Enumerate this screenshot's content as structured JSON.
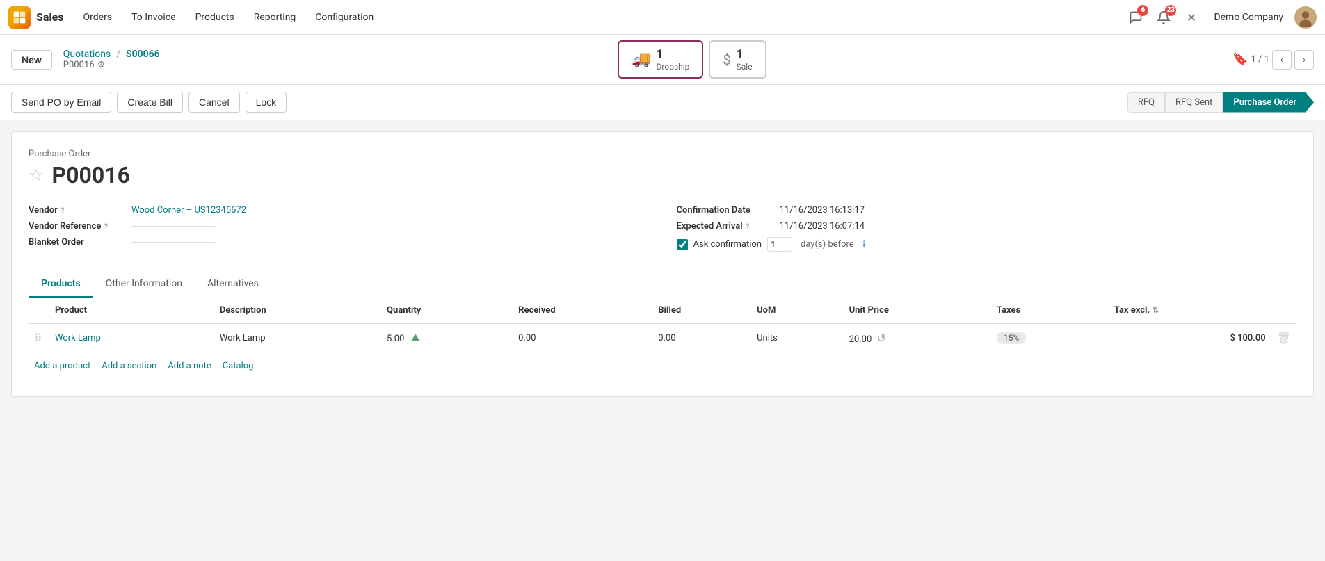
{
  "app": {
    "name": "Sales",
    "logo_color": "#f0a500"
  },
  "nav": {
    "items": [
      "Orders",
      "To Invoice",
      "Products",
      "Reporting",
      "Configuration"
    ],
    "company": "Demo Company",
    "notifications_count": "6",
    "messages_count": "23"
  },
  "breadcrumb": {
    "new_label": "New",
    "quotations_label": "Quotations",
    "current_label": "S00066",
    "po_ref": "P00016"
  },
  "smart_buttons": {
    "dropship": {
      "icon": "🚚",
      "label": "Dropship",
      "count": "1"
    },
    "sale": {
      "label": "Sale",
      "count": "1"
    }
  },
  "pagination": {
    "current": "1",
    "total": "1"
  },
  "action_buttons": {
    "send_po": "Send PO by Email",
    "create_bill": "Create Bill",
    "cancel": "Cancel",
    "lock": "Lock"
  },
  "status_steps": {
    "rfq": "RFQ",
    "rfq_sent": "RFQ Sent",
    "purchase_order": "Purchase Order"
  },
  "form": {
    "header_label": "Purchase Order",
    "po_number": "P00016",
    "vendor_label": "Vendor",
    "vendor_help": "?",
    "vendor_value": "Wood Corner – US12345672",
    "vendor_ref_label": "Vendor Reference",
    "vendor_ref_help": "?",
    "blanket_order_label": "Blanket Order",
    "confirmation_date_label": "Confirmation Date",
    "confirmation_date_value": "11/16/2023 16:13:17",
    "expected_arrival_label": "Expected Arrival",
    "expected_arrival_help": "?",
    "expected_arrival_value": "11/16/2023 16:07:14",
    "ask_confirmation_label": "Ask confirmation",
    "ask_confirmation_value": "1",
    "days_before_label": "day(s) before"
  },
  "tabs": {
    "products": "Products",
    "other_info": "Other Information",
    "alternatives": "Alternatives"
  },
  "table": {
    "headers": [
      "Product",
      "Description",
      "Quantity",
      "Received",
      "Billed",
      "UoM",
      "Unit Price",
      "Taxes",
      "Tax excl."
    ],
    "rows": [
      {
        "product": "Work Lamp",
        "description": "Work Lamp",
        "quantity": "5.00",
        "received": "0.00",
        "billed": "0.00",
        "uom": "Units",
        "unit_price": "20.00",
        "taxes": "15%",
        "tax_excl": "$ 100.00"
      }
    ]
  },
  "add_links": {
    "add_product": "Add a product",
    "add_section": "Add a section",
    "add_note": "Add a note",
    "catalog": "Catalog"
  }
}
